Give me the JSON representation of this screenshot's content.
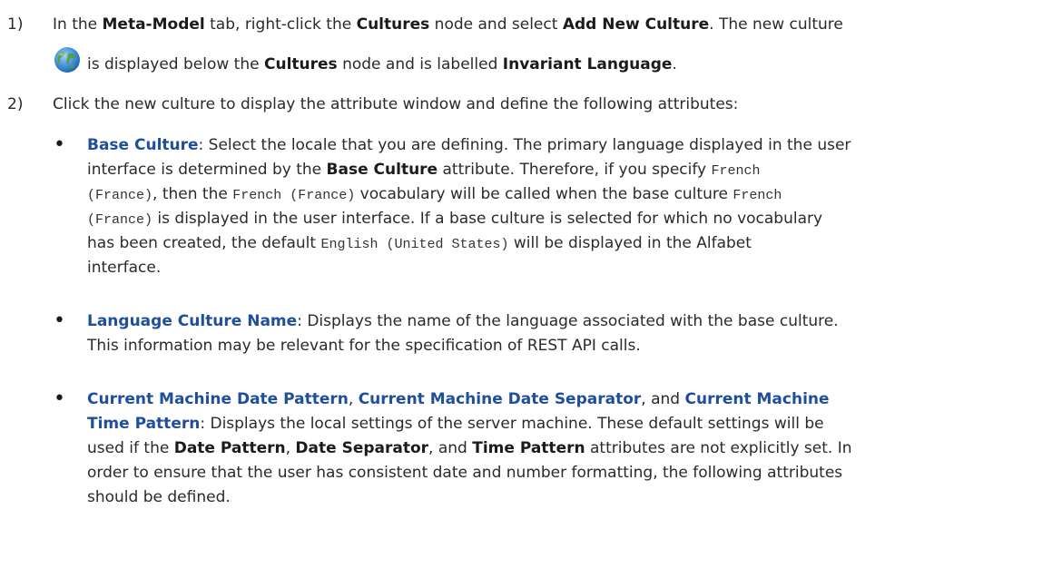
{
  "step1": {
    "num": "1)",
    "l1_a": "In the ",
    "l1_b": "Meta-Model",
    "l1_c": " tab, right-click the ",
    "l1_d": "Cultures",
    "l1_e": " node and select ",
    "l1_f": "Add New Culture",
    "l1_g": ". The new culture",
    "l2_a": " is displayed below the ",
    "l2_b": "Cultures",
    "l2_c": " node and is labelled ",
    "l2_d": "Invariant Language",
    "l2_e": "."
  },
  "step2": {
    "num": "2)",
    "text": "Click the new culture to display the attribute window and define the following attributes:"
  },
  "bullets": [
    {
      "dot": "•",
      "l1_a": "Base Culture",
      "l1_b": ": Select the locale that you are defining. The primary language displayed in the user",
      "l2_a": "interface is determined by the ",
      "l2_b": "Base Culture",
      "l2_c": " attribute. Therefore, if you specify ",
      "l2_d": "French",
      "l3_a": "(France)",
      "l3_b": ", then the ",
      "l3_c": "French (France)",
      "l3_d": " vocabulary will be called when the base culture ",
      "l3_e": "French",
      "l4_a": "(France)",
      "l4_b": " is displayed in the user interface. If a base culture is selected for which no vocabulary",
      "l5_a": "has been created, the default ",
      "l5_b": "English (United States)",
      "l5_c": " will be displayed in the Alfabet",
      "l6": "interface."
    },
    {
      "dot": "•",
      "l1_a": "Language Culture Name",
      "l1_b": ": Displays the name of the language associated with the base culture.",
      "l2": "This information may be relevant for the specification of REST API calls."
    },
    {
      "dot": "•",
      "l1_a": "Current Machine Date Pattern",
      "l1_b": ", ",
      "l1_c": "Current Machine Date Separator",
      "l1_d": ", and ",
      "l1_e": "Current Machine",
      "l2_a": "Time Pattern",
      "l2_b": ": Displays the local settings of the server machine. These default settings will be",
      "l3_a": "used if the ",
      "l3_b": "Date Pattern",
      "l3_c": ", ",
      "l3_d": "Date Separator",
      "l3_e": ", and ",
      "l3_f": "Time Pattern",
      "l3_g": " attributes are not explicitly set. In",
      "l4": "order to ensure that the user has consistent date and number formatting, the following attributes",
      "l5": "should be defined."
    }
  ],
  "icons": {
    "culture": "globe-icon"
  }
}
